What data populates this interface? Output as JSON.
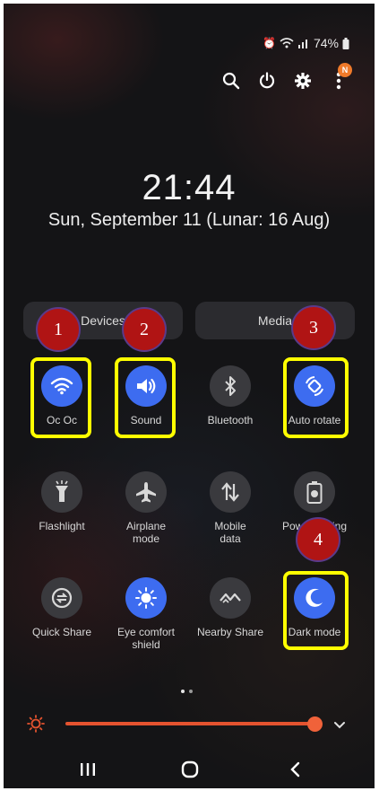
{
  "status_bar": {
    "battery": "74%",
    "icons": [
      "alarm-icon",
      "wifi-icon",
      "signal-icon",
      "battery-icon"
    ]
  },
  "toolbar": {
    "icons": [
      "search-icon",
      "power-icon",
      "gear-icon",
      "more-icon"
    ],
    "notification_badge": "N"
  },
  "lockscreen": {
    "time": "21:44",
    "date": "Sun, September 11 (Lunar: 16 Aug)"
  },
  "segments": [
    {
      "label": "Devices"
    },
    {
      "label": "Media"
    }
  ],
  "tiles": [
    {
      "label": "Oc Oc",
      "icon": "wifi-icon",
      "active": true
    },
    {
      "label": "Sound",
      "icon": "speaker-icon",
      "active": true
    },
    {
      "label": "Bluetooth",
      "icon": "bluetooth-icon",
      "active": false
    },
    {
      "label": "Auto rotate",
      "icon": "rotate-icon",
      "active": true
    },
    {
      "label": "Flashlight",
      "icon": "flashlight-icon",
      "active": false
    },
    {
      "label": "Airplane\nmode",
      "icon": "airplane-icon",
      "active": false
    },
    {
      "label": "Mobile\ndata",
      "icon": "mobile-data-icon",
      "active": false
    },
    {
      "label": "Power saving",
      "icon": "battery-saver-icon",
      "active": false
    },
    {
      "label": "Quick Share",
      "icon": "quick-share-icon",
      "active": false
    },
    {
      "label": "Eye comfort\nshield",
      "icon": "eye-comfort-icon",
      "active": true
    },
    {
      "label": "Nearby Share",
      "icon": "nearby-share-icon",
      "active": false
    },
    {
      "label": "Dark mode",
      "icon": "moon-icon",
      "active": true
    }
  ],
  "annotations": [
    "1",
    "2",
    "3",
    "4"
  ],
  "pager": {
    "current": 1,
    "total": 2
  },
  "brightness": {
    "level": 0.96,
    "color": "#e4532f"
  },
  "colors": {
    "accent": "#3d6cf0",
    "highlight": "#ffff00",
    "marker": "#b01414"
  },
  "nav_bar": [
    "recents-icon",
    "home-icon",
    "back-icon"
  ]
}
